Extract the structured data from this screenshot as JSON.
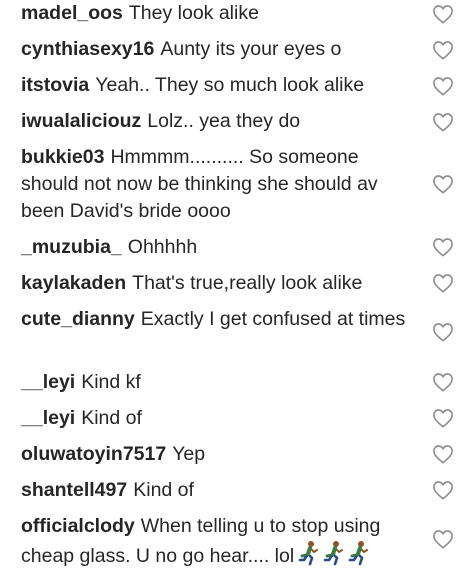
{
  "comments": [
    {
      "user": "madel_oos",
      "text": "They look alike"
    },
    {
      "user": "cynthiasexy16",
      "text": "Aunty its your eyes o"
    },
    {
      "user": "itstovia",
      "text": "Yeah.. They so much look alike"
    },
    {
      "user": "iwualaliciouz",
      "text": "Lolz.. yea they do"
    },
    {
      "user": "bukkie03",
      "text": "Hmmmm.......... So someone should not now be thinking she should av been David's bride oooo"
    },
    {
      "user": "_muzubia_",
      "text": "Ohhhhh"
    },
    {
      "user": "kaylakaden",
      "text": "That's true,really look alike"
    },
    {
      "user": "cute_dianny",
      "text": "Exactly I get confused at times"
    },
    {
      "user": "__leyi",
      "text": "Kind kf"
    },
    {
      "user": "__leyi",
      "text": "Kind of"
    },
    {
      "user": "oluwatoyin7517",
      "text": "Yep"
    },
    {
      "user": "shantell497",
      "text": "Kind of"
    },
    {
      "user": "officialclody",
      "text": "When telling u to stop using cheap glass. U no go hear.... lol",
      "emoji_icons": [
        "person-running-icon",
        "person-running-icon",
        "person-running-icon"
      ]
    }
  ],
  "colors": {
    "text": "#262626",
    "heart_outline": "#8e8e8e",
    "emoji_skin": "#8d5524",
    "emoji_shirt": "#3a7d44"
  }
}
